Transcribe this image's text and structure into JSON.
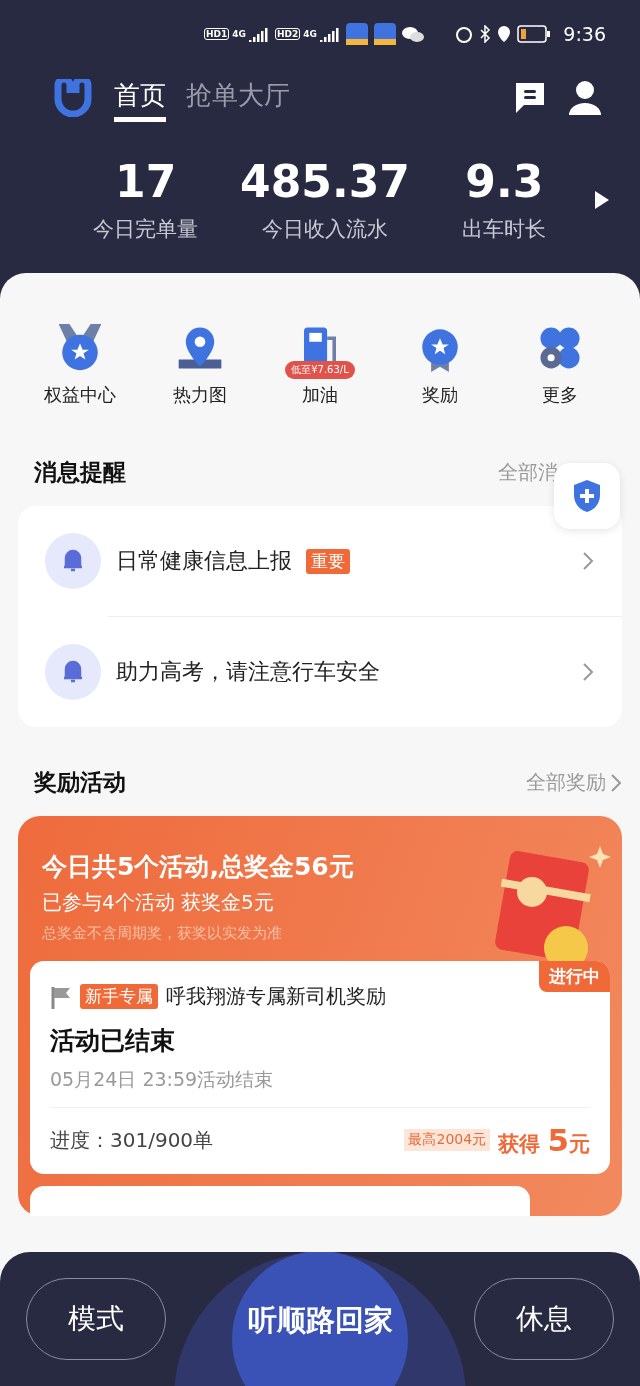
{
  "status_bar": {
    "sims": [
      {
        "hd": "HD",
        "slot": "1",
        "network": "4G"
      },
      {
        "hd": "HD",
        "slot": "2",
        "network": "4G"
      }
    ],
    "time": "9:36"
  },
  "header": {
    "tabs": [
      {
        "label": "首页",
        "selected": true
      },
      {
        "label": "抢单大厅",
        "selected": false
      }
    ]
  },
  "stats": [
    {
      "value": "17",
      "label": "今日完单量"
    },
    {
      "value": "485.37",
      "label": "今日收入流水"
    },
    {
      "value": "9.3",
      "label": "出车时长"
    }
  ],
  "shortcuts": [
    {
      "kind": "medal",
      "label": "权益中心"
    },
    {
      "kind": "map",
      "label": "热力图"
    },
    {
      "kind": "fuel",
      "label": "加油",
      "badge": "低至¥7.63/L"
    },
    {
      "kind": "reward",
      "label": "奖励"
    },
    {
      "kind": "more",
      "label": "更多"
    }
  ],
  "messages": {
    "title": "消息提醒",
    "link": "全部消",
    "items": [
      {
        "text": "日常健康信息上报",
        "tag": "重要"
      },
      {
        "text": "助力高考，请注意行车安全"
      }
    ]
  },
  "rewards": {
    "title": "奖励活动",
    "link": "全部奖励",
    "headline": "今日共5个活动,总奖金56元",
    "summary": "已参与4个活动 获奖金5元",
    "note": "总奖金不含周期奖，获奖以实发为准",
    "activity": {
      "status": "进行中",
      "tag": "新手专属",
      "name": "呼我翔游专属新司机奖励",
      "state": "活动已结束",
      "deadline": "05月24日 23:59活动结束",
      "progress": "进度：301/900单",
      "max": "最高2004元",
      "earned_label": "获得",
      "earned_value": "5",
      "earned_unit": "元"
    }
  },
  "bottom_bar": {
    "left": "模式",
    "center": "听顺路回家",
    "right": "休息"
  }
}
